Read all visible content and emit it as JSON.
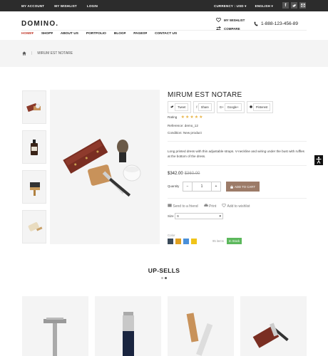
{
  "topbar": {
    "my_account": "MY ACCOUNT",
    "my_wishlist": "MY WISHLIST",
    "login": "LOGIN",
    "currency": "CURRENCY : USD",
    "language": "ENGLISH",
    "social": [
      "f",
      "t",
      "mail"
    ]
  },
  "header": {
    "logo": "DOMINO.",
    "wishlist": "MY WISHLIST",
    "compare": "COMPARE",
    "phone": "1-888-123-456-89"
  },
  "nav": {
    "items": [
      {
        "label": "HOME",
        "dropdown": true,
        "active": true
      },
      {
        "label": "SHOP",
        "dropdown": true
      },
      {
        "label": "ABOUT US"
      },
      {
        "label": "PORTFOLIO"
      },
      {
        "label": "BLOG",
        "dropdown": true
      },
      {
        "label": "PAGES",
        "dropdown": true
      },
      {
        "label": "CONTACT US"
      }
    ]
  },
  "breadcrumb": {
    "current": "MIRUM EST NOTARE"
  },
  "product": {
    "title": "MIRUM EST NOTARE",
    "share": [
      "Tweet",
      "Share",
      "Google+",
      "Pinterest"
    ],
    "rating_label": "Rating",
    "rating": 5,
    "reference_label": "Reference:",
    "reference": "demo_12",
    "condition_label": "Condition:",
    "condition": "New product",
    "description": "Long printed dress with thin adjustable straps. V-neckline and wiring under the bust with ruffles at the bottom of the dress.",
    "price": "$342.00",
    "old_price": "$360.00",
    "quantity_label": "Quantity",
    "quantity": "1",
    "add_to_cart": "ADD TO CART",
    "send_friend": "Send to a friend",
    "print": "Print",
    "add_wishlist": "Add to wishlist",
    "size_label": "Size",
    "size_value": "S",
    "color_label": "Color",
    "colors": [
      "#3a4a5a",
      "#e0a020",
      "#4a90d9",
      "#f0c419"
    ],
    "items_text": "95 items",
    "stock": "In Stock"
  },
  "upsells": {
    "title": "UP-SELLS"
  },
  "colors": {
    "accent": "#c0392b",
    "cart": "#9c7b68",
    "instock": "#5cb85c",
    "star": "#e8b54a"
  }
}
